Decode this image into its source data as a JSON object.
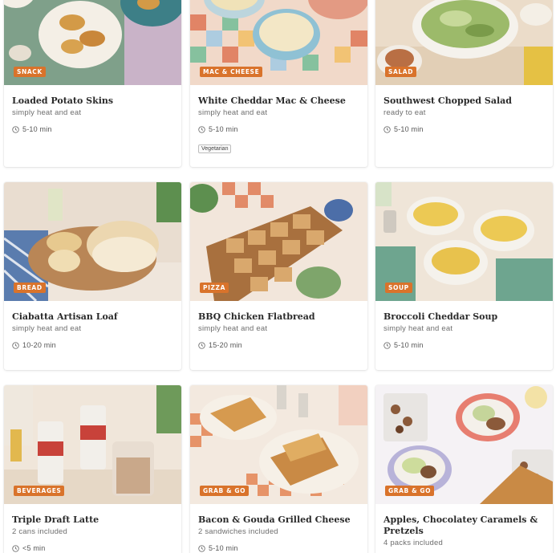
{
  "cards": [
    {
      "tag": "SNACK",
      "title": "Loaded Potato Skins",
      "subtitle": "simply heat and eat",
      "time": "5-10 min",
      "badge": ""
    },
    {
      "tag": "MAC & CHEESE",
      "title": "White Cheddar Mac & Cheese",
      "subtitle": "simply heat and eat",
      "time": "5-10 min",
      "badge": "Vegetarian"
    },
    {
      "tag": "SALAD",
      "title": "Southwest Chopped Salad",
      "subtitle": "ready to eat",
      "time": "5-10 min",
      "badge": ""
    },
    {
      "tag": "BREAD",
      "title": "Ciabatta Artisan Loaf",
      "subtitle": "simply heat and eat",
      "time": "10-20 min",
      "badge": ""
    },
    {
      "tag": "PIZZA",
      "title": "BBQ Chicken Flatbread",
      "subtitle": "simply heat and eat",
      "time": "15-20 min",
      "badge": ""
    },
    {
      "tag": "SOUP",
      "title": "Broccoli Cheddar Soup",
      "subtitle": "simply heat and eat",
      "time": "5-10 min",
      "badge": ""
    },
    {
      "tag": "BEVERAGES",
      "title": "Triple Draft Latte",
      "subtitle": "2 cans included",
      "time": "<5 min",
      "badge": ""
    },
    {
      "tag": "GRAB & GO",
      "title": "Bacon & Gouda Grilled Cheese",
      "subtitle": "2 sandwiches included",
      "time": "5-10 min",
      "badge": ""
    },
    {
      "tag": "GRAB & GO",
      "title": "Apples, Chocolatey Caramels & Pretzels",
      "subtitle": "4 packs included",
      "time": "",
      "badge": ""
    }
  ],
  "icons": {
    "clock": "clock-icon"
  },
  "colors": {
    "tag_bg": "#d9732b",
    "card_bg": "#ffffff"
  }
}
